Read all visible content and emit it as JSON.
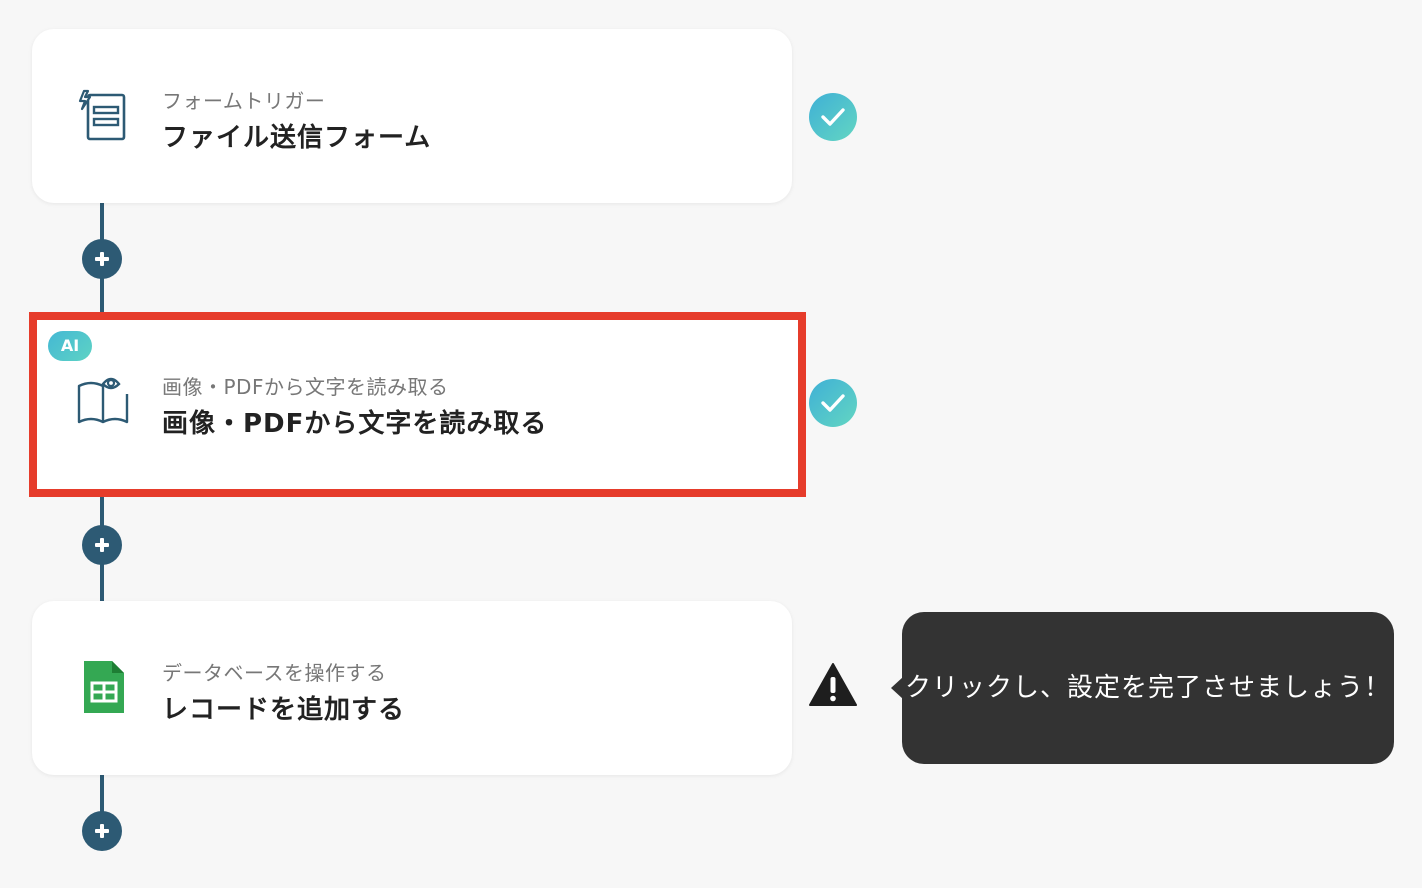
{
  "steps": [
    {
      "subtitle": "フォームトリガー",
      "title": "ファイル送信フォーム",
      "icon": "form-trigger-icon",
      "status": "complete"
    },
    {
      "badge": "AI",
      "subtitle": "画像・PDFから文字を読み取る",
      "title": "画像・PDFから文字を読み取る",
      "icon": "book-eye-icon",
      "status": "complete",
      "highlighted": true
    },
    {
      "subtitle": "データベースを操作する",
      "title": "レコードを追加する",
      "icon": "google-sheets-icon",
      "status": "warning"
    }
  ],
  "tooltip": {
    "text": "クリックし、設定を完了させましょう！"
  },
  "colors": {
    "connector": "#2d5a74",
    "highlight": "#e63c2b",
    "check_gradient": [
      "#44b8d4",
      "#5ed3c4"
    ],
    "sheets_green": "#34a853",
    "tooltip_bg": "#333333"
  }
}
